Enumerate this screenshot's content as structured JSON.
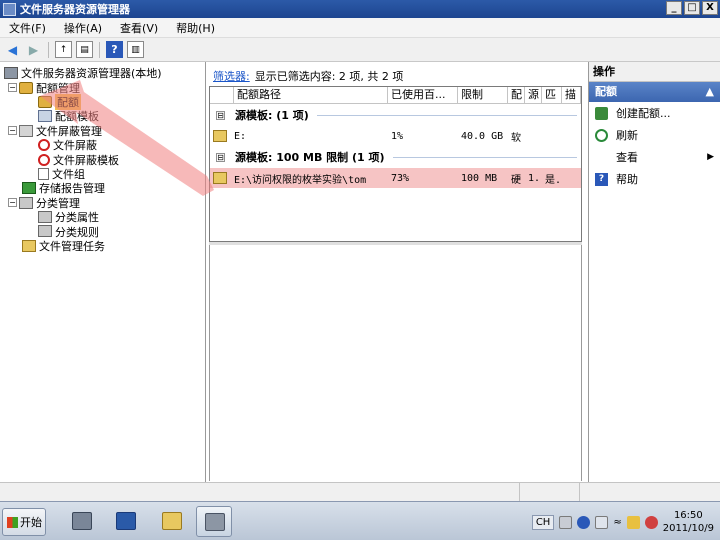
{
  "window": {
    "title": "文件服务器资源管理器",
    "buttons": [
      "_",
      "□",
      "X"
    ]
  },
  "menu": [
    "文件(F)",
    "操作(A)",
    "查看(V)",
    "帮助(H)"
  ],
  "tree": {
    "root": "文件服务器资源管理器(本地)",
    "quota_mgmt": "配额管理",
    "quotas": "配额",
    "quota_templates": "配额模板",
    "screen_mgmt": "文件屏蔽管理",
    "screens": "文件屏蔽",
    "screen_templates": "文件屏蔽模板",
    "file_groups": "文件组",
    "reports": "存储报告管理",
    "classification": "分类管理",
    "class_props": "分类属性",
    "class_rules": "分类规则",
    "file_tasks": "文件管理任务"
  },
  "filter": {
    "link": "筛选器:",
    "text": "显示已筛选内容: 2 项, 共 2 项"
  },
  "list": {
    "columns": [
      "配额路径",
      "已使用百...",
      "限制",
      "配",
      "源",
      "匹",
      "描"
    ],
    "groups": [
      {
        "expander": "⊟",
        "label": "源模板:  (1 项)",
        "rows": [
          {
            "path": "E:",
            "used": "1%",
            "limit": "40.0 GB",
            "type": "软",
            "source": "",
            "match": "",
            "desc": ""
          }
        ]
      },
      {
        "expander": "⊟",
        "label": "源模板: 100 MB 限制  (1 项)",
        "rows": [
          {
            "path": "E:\\访问权限的枚举实验\\tom",
            "used": "73%",
            "limit": "100 MB",
            "type": "硬",
            "source": "1..",
            "match": "是.",
            "desc": ""
          }
        ]
      }
    ]
  },
  "actions": {
    "header": "操作",
    "section": "配额",
    "section_arrow": "▲",
    "items": [
      {
        "label": "创建配额...",
        "arrow": ""
      },
      {
        "label": "刷新",
        "arrow": ""
      },
      {
        "label": "查看",
        "arrow": "▶"
      },
      {
        "label": "帮助",
        "arrow": ""
      }
    ]
  },
  "taskbar": {
    "start": "开始",
    "lang": "CH",
    "time": "16:50",
    "date": "2011/10/9"
  },
  "colors": {
    "selected_row": "#f6c4c4",
    "accent": "#3c66b0"
  }
}
